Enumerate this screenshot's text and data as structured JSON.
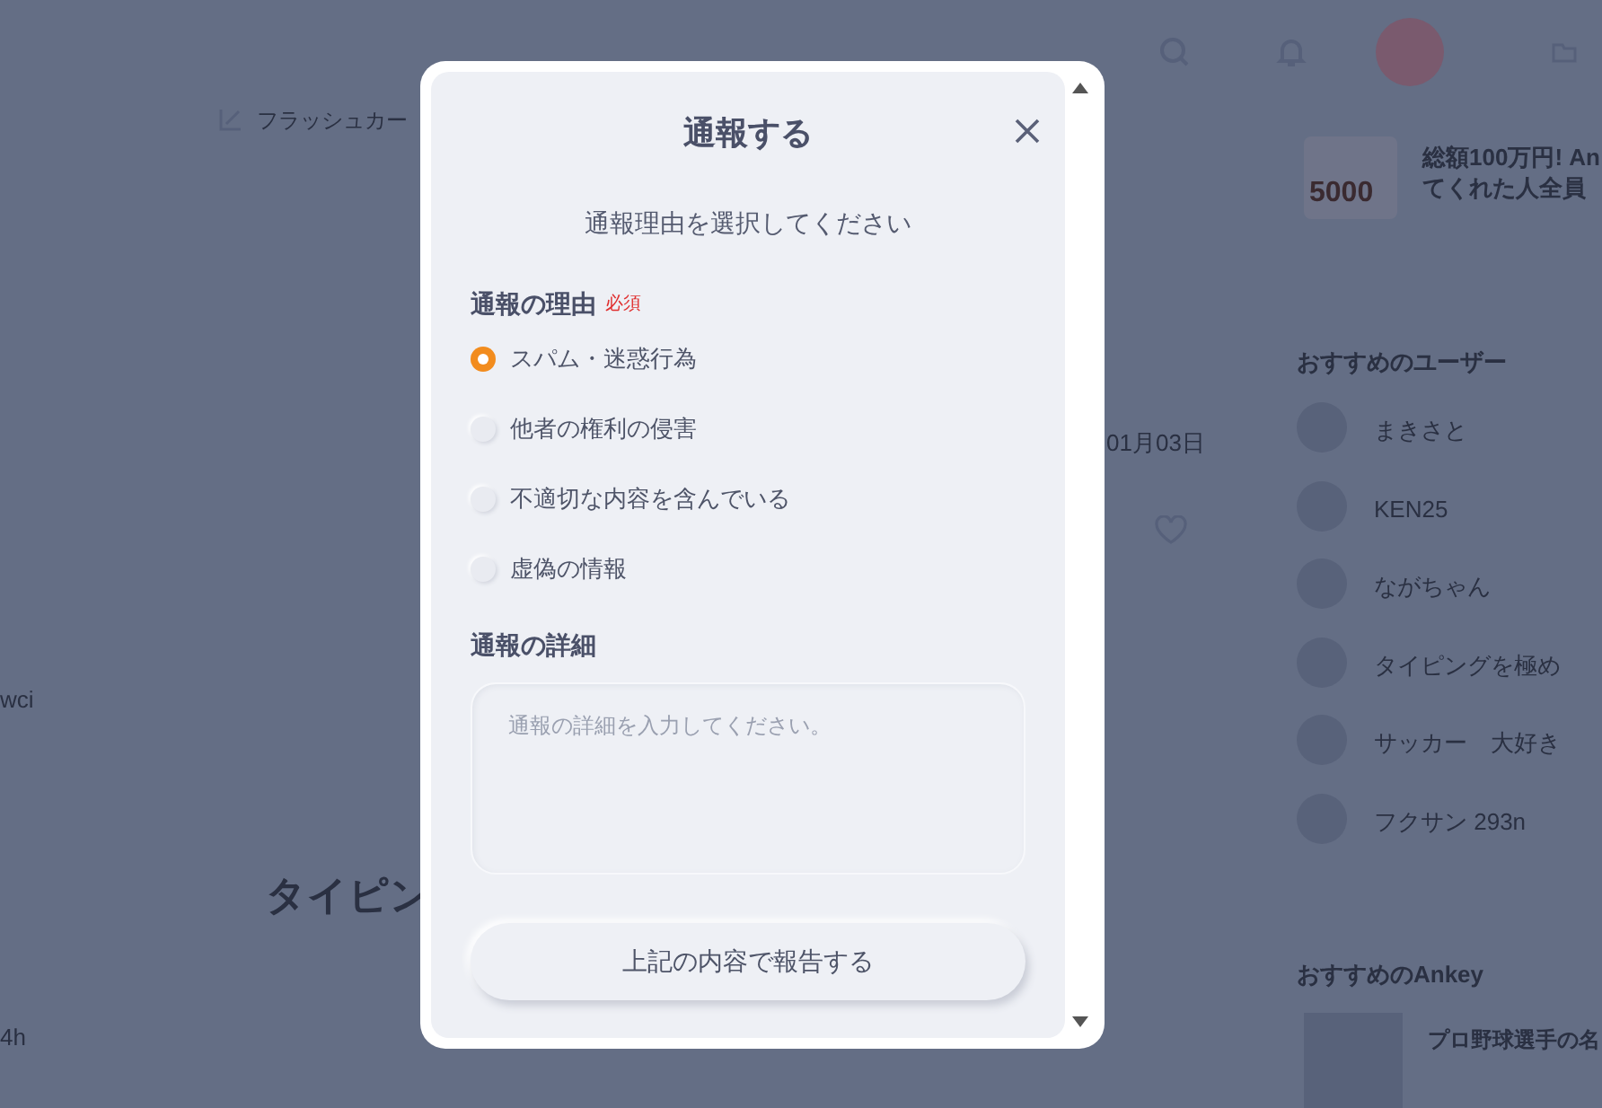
{
  "background": {
    "header_link": "フラッシュカー",
    "post_date": "01月03日",
    "author_fragment": "wci",
    "heading_fragment": "タイピン",
    "footer_fragment": "4h",
    "banner": {
      "badge": "5000",
      "title_line_1": "総額100万円! An",
      "title_line_2": "てくれた人全員"
    },
    "recommended_users": {
      "title": "おすすめのユーザー",
      "users": [
        "まきさと",
        "KEN25",
        "ながちゃん",
        "タイピングを極め",
        "サッカー　大好き",
        "フクサン 293n"
      ]
    },
    "recommended_ankey": {
      "title": "おすすめのAnkey",
      "item": "プロ野球選手の名"
    }
  },
  "dialog": {
    "title": "通報する",
    "subtitle": "通報理由を選択してください",
    "reason": {
      "label": "通報の理由",
      "required": "必須",
      "options": [
        {
          "label": "スパム・迷惑行為",
          "selected": true
        },
        {
          "label": "他者の権利の侵害",
          "selected": false
        },
        {
          "label": "不適切な内容を含んでいる",
          "selected": false
        },
        {
          "label": "虚偽の情報",
          "selected": false
        }
      ]
    },
    "details": {
      "label": "通報の詳細",
      "placeholder": "通報の詳細を入力してください。"
    },
    "submit": "上記の内容で報告する"
  }
}
